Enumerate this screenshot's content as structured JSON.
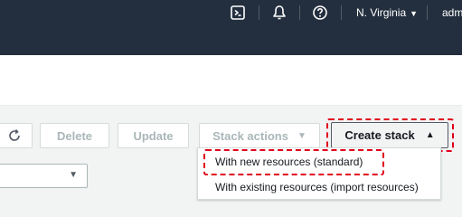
{
  "topnav": {
    "icons": [
      "cloudshell-icon",
      "bell-icon",
      "help-icon"
    ],
    "region_label": "N. Virginia",
    "user_label": "adm",
    "background": "#232f3e"
  },
  "toolbar": {
    "delete_label": "Delete",
    "update_label": "Update",
    "stack_actions_label": "Stack actions",
    "create_stack_label": "Create stack"
  },
  "create_menu": {
    "items": [
      {
        "label": "With new resources (standard)"
      },
      {
        "label": "With existing resources (import resources)"
      }
    ]
  },
  "colors": {
    "highlight": "#e0001b",
    "disabled_text": "#aab7b8",
    "primary_text": "#16191f"
  }
}
